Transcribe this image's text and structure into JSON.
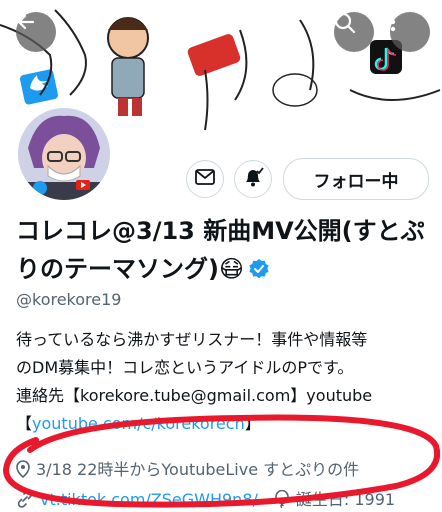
{
  "header": {
    "back_icon": "arrow-left-icon",
    "search_icon": "search-icon",
    "more_icon": "more-vertical-icon"
  },
  "actions": {
    "message_icon": "envelope-icon",
    "notify_icon": "bell-check-icon",
    "follow_label": "フォロー中"
  },
  "profile": {
    "display_name": "コレコレ@3/13 新曲MV公開(すとぷりのテーマソング)😷",
    "verified": true,
    "handle": "@korekore19",
    "bio_lines": [
      "待っているなら沸かすぜリスナー！事件や情報等",
      "のDM募集中！コレ恋というアイドルのPです。",
      "連絡先【korekore.tube@gmail.com】youtube",
      "【",
      "youtube.com/c/korekorech",
      "】"
    ],
    "location": "3/18 22時半からYoutubeLive すとぷりの件",
    "website": "vt.tiktok.com/ZSeGWH9n8/",
    "birthday": "誕生日: 1991"
  },
  "colors": {
    "accent": "#1d9bf0",
    "annotation": "#e8192c",
    "muted": "#536471"
  }
}
